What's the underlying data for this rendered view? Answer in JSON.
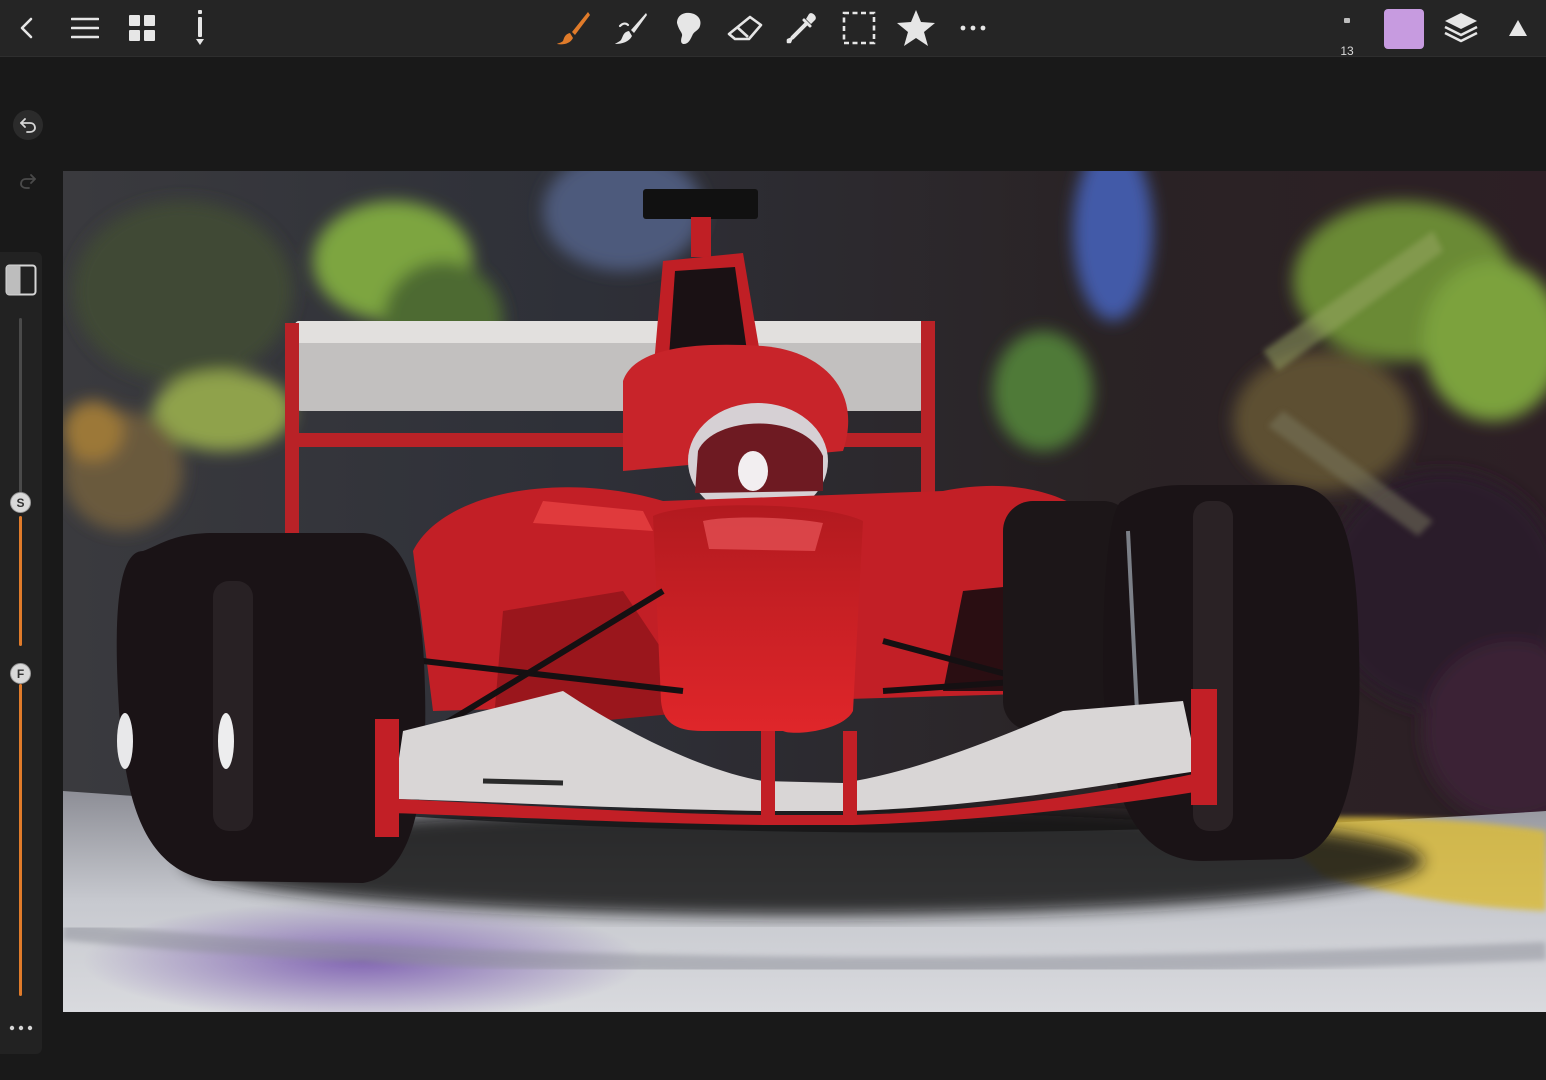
{
  "toolbar": {
    "left": [
      {
        "name": "back-icon"
      },
      {
        "name": "menu-icon"
      },
      {
        "name": "grid-icon"
      },
      {
        "name": "info-icon"
      }
    ],
    "tools": [
      {
        "name": "paint-brush-icon",
        "active": true
      },
      {
        "name": "smudge-brush-icon"
      },
      {
        "name": "blender-icon"
      },
      {
        "name": "eraser-icon"
      },
      {
        "name": "eyedropper-icon"
      },
      {
        "name": "selection-icon"
      },
      {
        "name": "favorites-star-icon"
      },
      {
        "name": "more-tools-icon"
      }
    ],
    "brush_size": "13",
    "current_color": "#c79be0",
    "right": [
      {
        "name": "layers-icon"
      },
      {
        "name": "collapse-toolbar-icon"
      }
    ]
  },
  "side": {
    "undo": "undo-icon",
    "redo": "redo-icon",
    "split_view": "split-view-icon",
    "size_slider_label": "S",
    "flow_slider_label": "F",
    "more": "more-options-icon"
  },
  "canvas": {
    "subject": "painting-formula-one-car"
  },
  "colors": {
    "accent": "#e07b2a",
    "toolbar_bg": "#252525",
    "app_bg": "#191919"
  }
}
